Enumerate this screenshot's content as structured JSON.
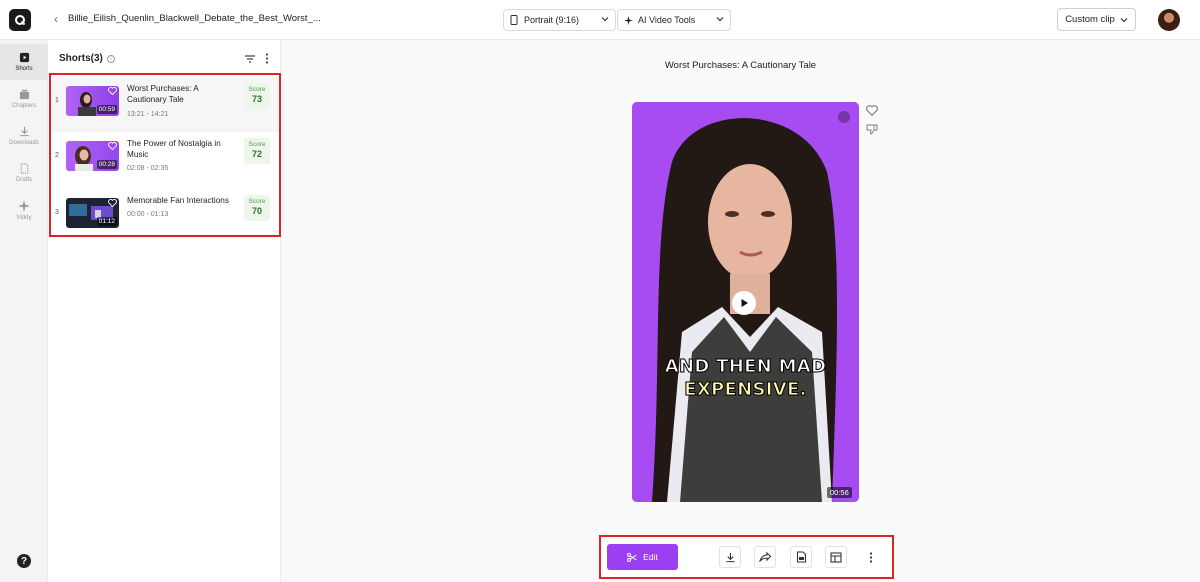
{
  "header": {
    "project_title": "Billie_Eilish_Quenlin_Blackwell_Debate_the_Best_Worst_...",
    "aspect_dropdown": "Portrait (9:16)",
    "tools_dropdown": "AI Video Tools",
    "custom_clip_label": "Custom clip"
  },
  "rail": {
    "items": [
      {
        "label": "Shorts",
        "icon": "shorts-icon"
      },
      {
        "label": "Chapters",
        "icon": "chapters-icon"
      },
      {
        "label": "Downloads",
        "icon": "download-icon"
      },
      {
        "label": "Drafts",
        "icon": "drafts-icon"
      },
      {
        "label": "Viddy",
        "icon": "sparkle-icon"
      }
    ]
  },
  "panel": {
    "heading": "Shorts(3)",
    "shorts": [
      {
        "index": "1",
        "title": "Worst Purchases: A Cautionary Tale",
        "time": "13:21 - 14:21",
        "duration": "00:59",
        "score_label": "Score",
        "score": "73"
      },
      {
        "index": "2",
        "title": "The Power of Nostalgia in Music",
        "time": "02:08 - 02:35",
        "duration": "00:28",
        "score_label": "Score",
        "score": "72"
      },
      {
        "index": "3",
        "title": "Memorable Fan Interactions",
        "time": "00:00 - 01:13",
        "duration": "01:12",
        "score_label": "Score",
        "score": "70"
      }
    ]
  },
  "preview": {
    "title": "Worst Purchases: A Cautionary Tale",
    "caption_line1": "AND THEN MAD",
    "caption_line2": "EXPENSIVE.",
    "duration": "00:56"
  },
  "toolbar": {
    "edit_label": "Edit"
  },
  "colors": {
    "accent": "#9a3ff2",
    "highlight_box": "#e02424",
    "score_green": "#2f6e2d"
  }
}
